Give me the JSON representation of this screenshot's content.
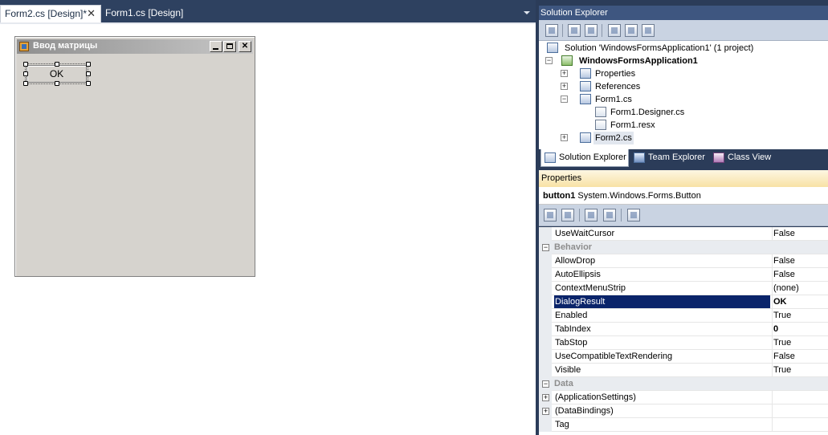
{
  "document_tabs": [
    {
      "label": "Form2.cs [Design]*",
      "active": true,
      "close_glyph": "✕"
    },
    {
      "label": "Form1.cs [Design]",
      "active": false
    }
  ],
  "form": {
    "title": "Ввод матрицы",
    "button_label": "OK"
  },
  "solution_explorer": {
    "header": "Solution Explorer",
    "tree": [
      {
        "label": "Solution 'WindowsFormsApplication1' (1 project)",
        "icon": "solution-icon"
      },
      {
        "label": "WindowsFormsApplication1",
        "icon": "csharp-project-icon",
        "expander": "−"
      },
      {
        "label": "Properties",
        "icon": "properties-folder-icon",
        "expander": "+"
      },
      {
        "label": "References",
        "icon": "references-icon",
        "expander": "+"
      },
      {
        "label": "Form1.cs",
        "icon": "form-icon",
        "expander": "−"
      },
      {
        "label": "Form1.Designer.cs",
        "icon": "cs-file-icon"
      },
      {
        "label": "Form1.resx",
        "icon": "resx-file-icon"
      },
      {
        "label": "Form2.cs",
        "icon": "form-icon",
        "expander": "+"
      }
    ],
    "tabs": [
      {
        "label": "Solution Explorer",
        "icon": "solution-explorer-icon",
        "active": true
      },
      {
        "label": "Team Explorer",
        "icon": "team-explorer-icon",
        "active": false
      },
      {
        "label": "Class View",
        "icon": "class-view-icon",
        "active": false
      }
    ]
  },
  "properties": {
    "header": "Properties",
    "object_name": "button1",
    "object_type": "System.Windows.Forms.Button",
    "rows": [
      {
        "kind": "prop",
        "name": "UseWaitCursor",
        "value": "False"
      },
      {
        "kind": "cat",
        "name": "Behavior",
        "expander": "−"
      },
      {
        "kind": "prop",
        "name": "AllowDrop",
        "value": "False"
      },
      {
        "kind": "prop",
        "name": "AutoEllipsis",
        "value": "False"
      },
      {
        "kind": "prop",
        "name": "ContextMenuStrip",
        "value": "(none)"
      },
      {
        "kind": "prop",
        "name": "DialogResult",
        "value": "OK",
        "selected": true,
        "bold": true
      },
      {
        "kind": "prop",
        "name": "Enabled",
        "value": "True"
      },
      {
        "kind": "prop",
        "name": "TabIndex",
        "value": "0",
        "bold": true
      },
      {
        "kind": "prop",
        "name": "TabStop",
        "value": "True"
      },
      {
        "kind": "prop",
        "name": "UseCompatibleTextRendering",
        "value": "False"
      },
      {
        "kind": "prop",
        "name": "Visible",
        "value": "True"
      },
      {
        "kind": "cat",
        "name": "Data",
        "expander": "−"
      },
      {
        "kind": "prop",
        "name": "(ApplicationSettings)",
        "value": "",
        "expander": "+"
      },
      {
        "kind": "prop",
        "name": "(DataBindings)",
        "value": "",
        "expander": "+"
      },
      {
        "kind": "prop",
        "name": "Tag",
        "value": ""
      }
    ]
  },
  "colors": {
    "ide_background": "#2b3c59",
    "selection": "#0a246a",
    "properties_header": "#f8e2a5"
  }
}
